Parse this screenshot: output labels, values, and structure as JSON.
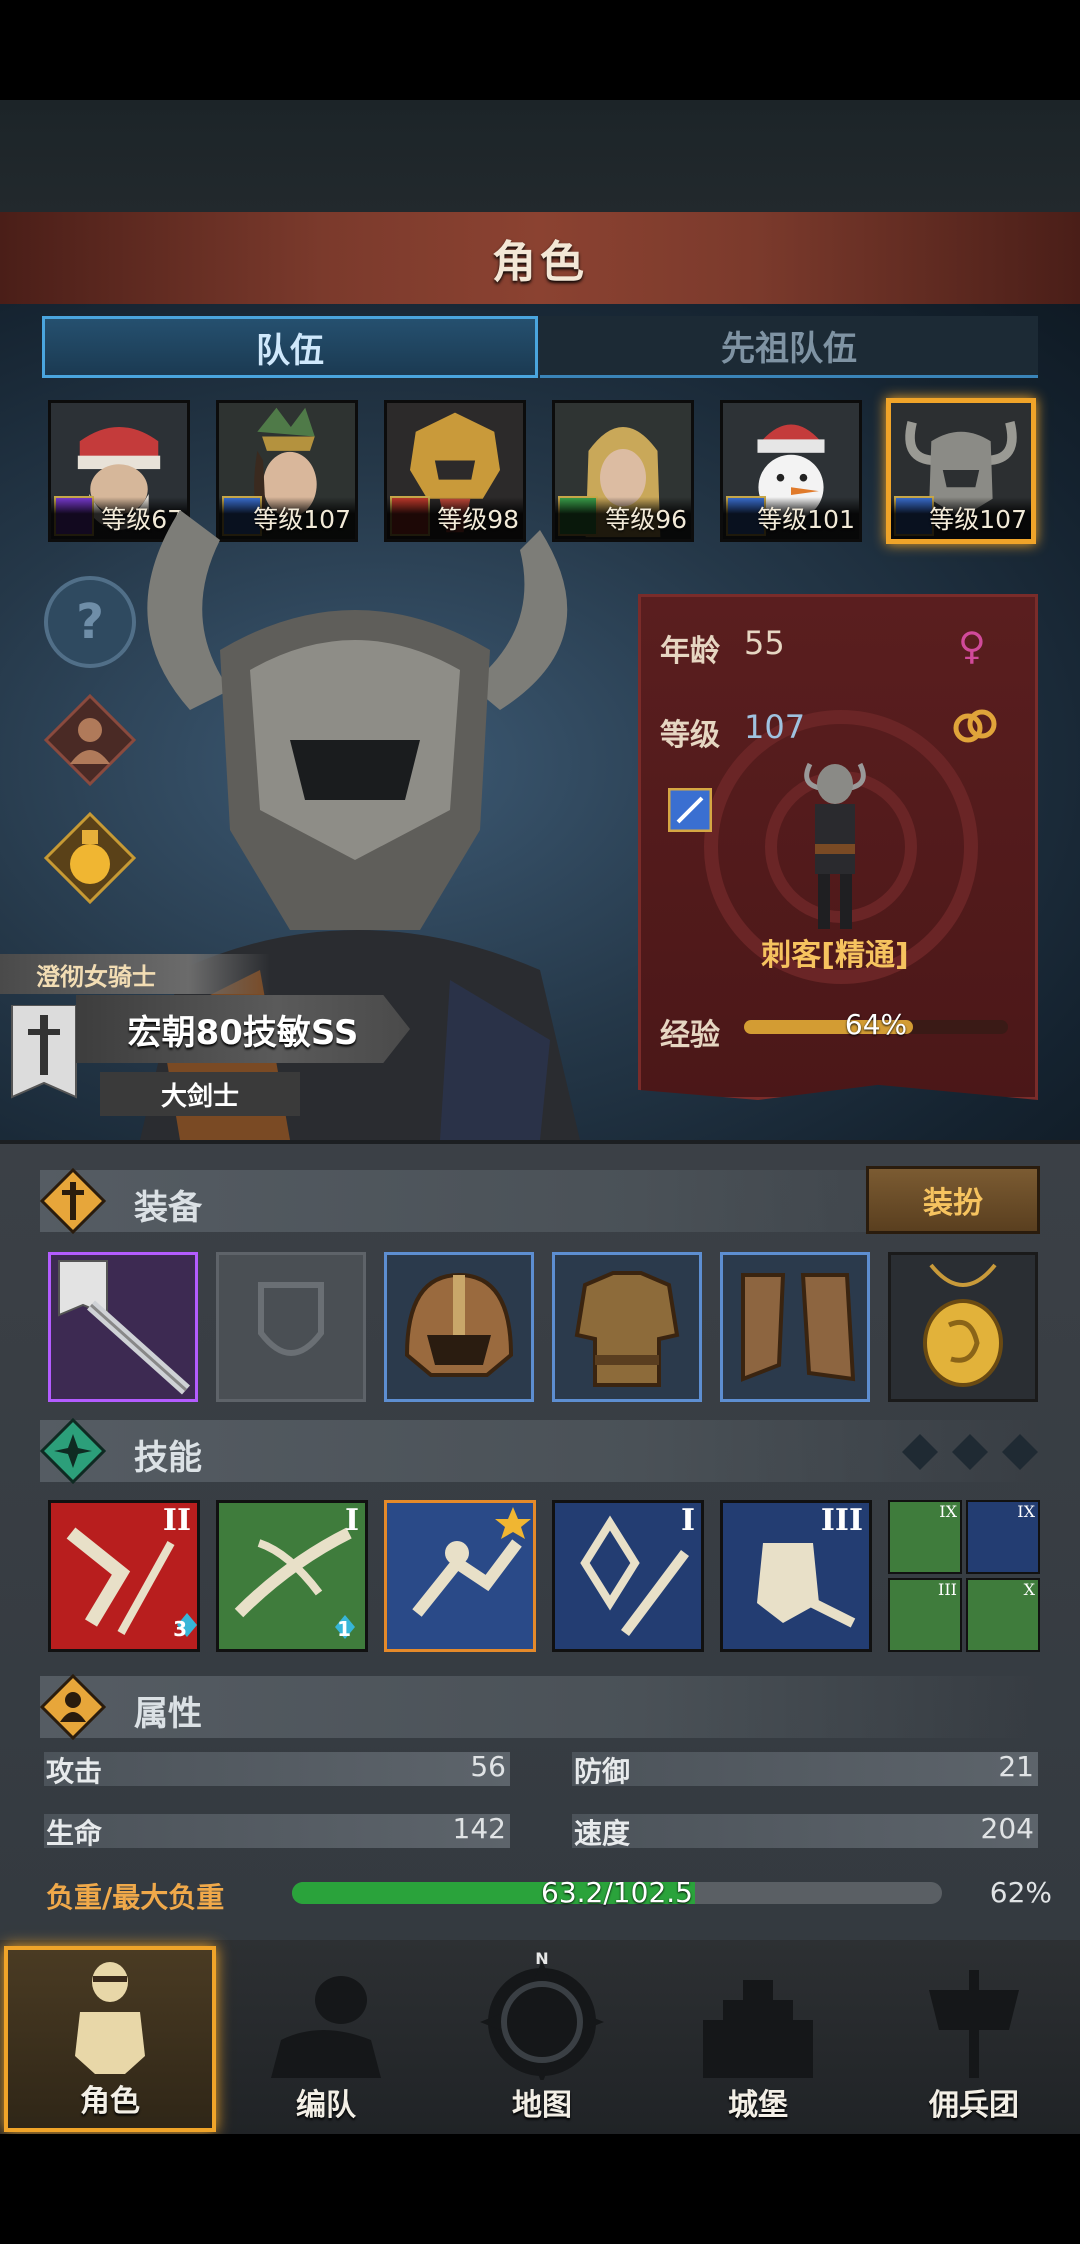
{
  "title": "角色",
  "tabs": [
    {
      "label": "队伍",
      "active": true
    },
    {
      "label": "先祖队伍",
      "active": false
    }
  ],
  "roster": [
    {
      "level_text": "等级67",
      "class_color": "#7a3ad1",
      "selected": false
    },
    {
      "level_text": "等级107",
      "class_color": "#3a6fd1",
      "selected": false
    },
    {
      "level_text": "等级98",
      "class_color": "#c0392b",
      "selected": false
    },
    {
      "level_text": "等级96",
      "class_color": "#3aa14a",
      "selected": false
    },
    {
      "level_text": "等级101",
      "class_color": "#3a6fd1",
      "selected": false
    },
    {
      "level_text": "等级107",
      "class_color": "#3a6fd1",
      "selected": true
    }
  ],
  "side_icons": [
    "question-icon",
    "villager-icon",
    "potion-icon"
  ],
  "hero": {
    "class_tag": "澄彻女骑士",
    "name": "宏朝80技敏SS",
    "subclass": "大剑士"
  },
  "info": {
    "age_label": "年龄",
    "age": "55",
    "level_label": "等级",
    "level": "107",
    "profession": "刺客[精通]",
    "exp_label": "经验",
    "exp_percent_text": "64%",
    "exp_fraction": 0.64,
    "gender": "female-icon",
    "ring": "rings-icon"
  },
  "equipment": {
    "title": "装备",
    "dress_button": "装扮",
    "slots": [
      "greatsword-banner",
      "empty-shield",
      "leather-helmet",
      "leather-armor",
      "leather-boots",
      "gold-amulet"
    ]
  },
  "skills": {
    "title": "技能",
    "items": [
      {
        "rank": "II",
        "badge": "3",
        "bg": "#b81e1e"
      },
      {
        "rank": "I",
        "badge": "1",
        "bg": "#3f7c3c"
      },
      {
        "rank": "",
        "badge": "",
        "bg": "#2a4a88",
        "star": true
      },
      {
        "rank": "I",
        "badge": "",
        "bg": "#233d72"
      },
      {
        "rank": "III",
        "badge": "",
        "bg": "#233d72"
      }
    ],
    "mini": [
      "IX",
      "IX",
      "III",
      "X"
    ]
  },
  "attributes": {
    "title": "属性",
    "attack_label": "攻击",
    "attack": "56",
    "defense_label": "防御",
    "defense": "21",
    "hp_label": "生命",
    "hp": "142",
    "speed_label": "速度",
    "speed": "204",
    "load_label": "负重/最大负重",
    "load_text": "63.2/102.5",
    "load_percent_text": "62%",
    "load_fraction": 0.62
  },
  "nav": [
    {
      "label": "角色",
      "active": true
    },
    {
      "label": "编队",
      "active": false
    },
    {
      "label": "地图",
      "active": false
    },
    {
      "label": "城堡",
      "active": false
    },
    {
      "label": "佣兵团",
      "active": false
    }
  ],
  "colors": {
    "accent": "#f0a429",
    "tab_blue": "#4aa5de",
    "panel_red": "#5a1e1f",
    "load_green": "#2aa33b"
  }
}
